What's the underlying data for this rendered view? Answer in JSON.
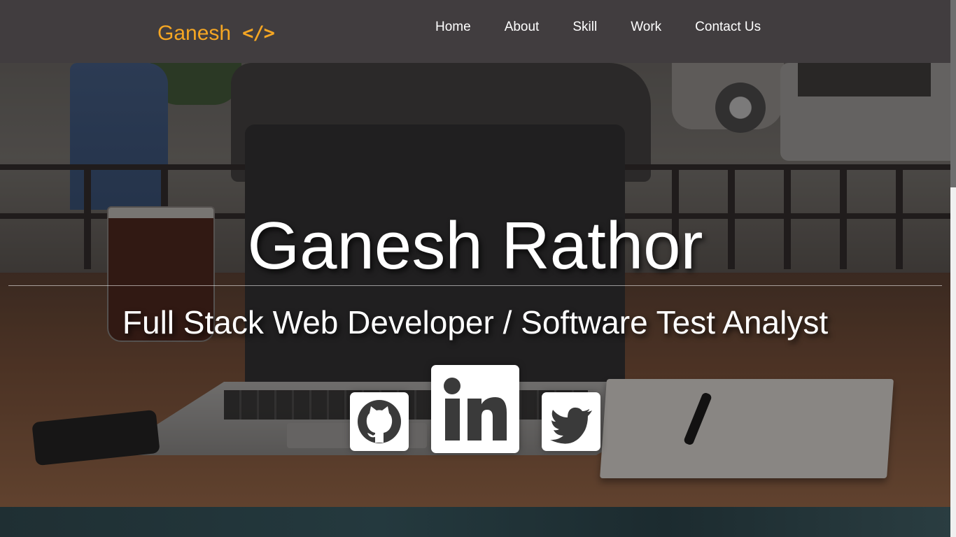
{
  "navbar": {
    "brand": {
      "text": "Ganesh",
      "icon_text": "</>",
      "color": "#f5a623"
    },
    "links": [
      {
        "label": "Home"
      },
      {
        "label": "About"
      },
      {
        "label": "Skill"
      },
      {
        "label": "Work"
      },
      {
        "label": "Contact Us"
      }
    ],
    "background": "#413d3f"
  },
  "hero": {
    "title": "Ganesh Rathor",
    "subtitle": "Full Stack Web Developer / Software Test Analyst"
  },
  "social": [
    {
      "name": "github",
      "icon": "github-icon"
    },
    {
      "name": "linkedin",
      "icon": "linkedin-icon"
    },
    {
      "name": "twitter",
      "icon": "twitter-icon"
    }
  ]
}
